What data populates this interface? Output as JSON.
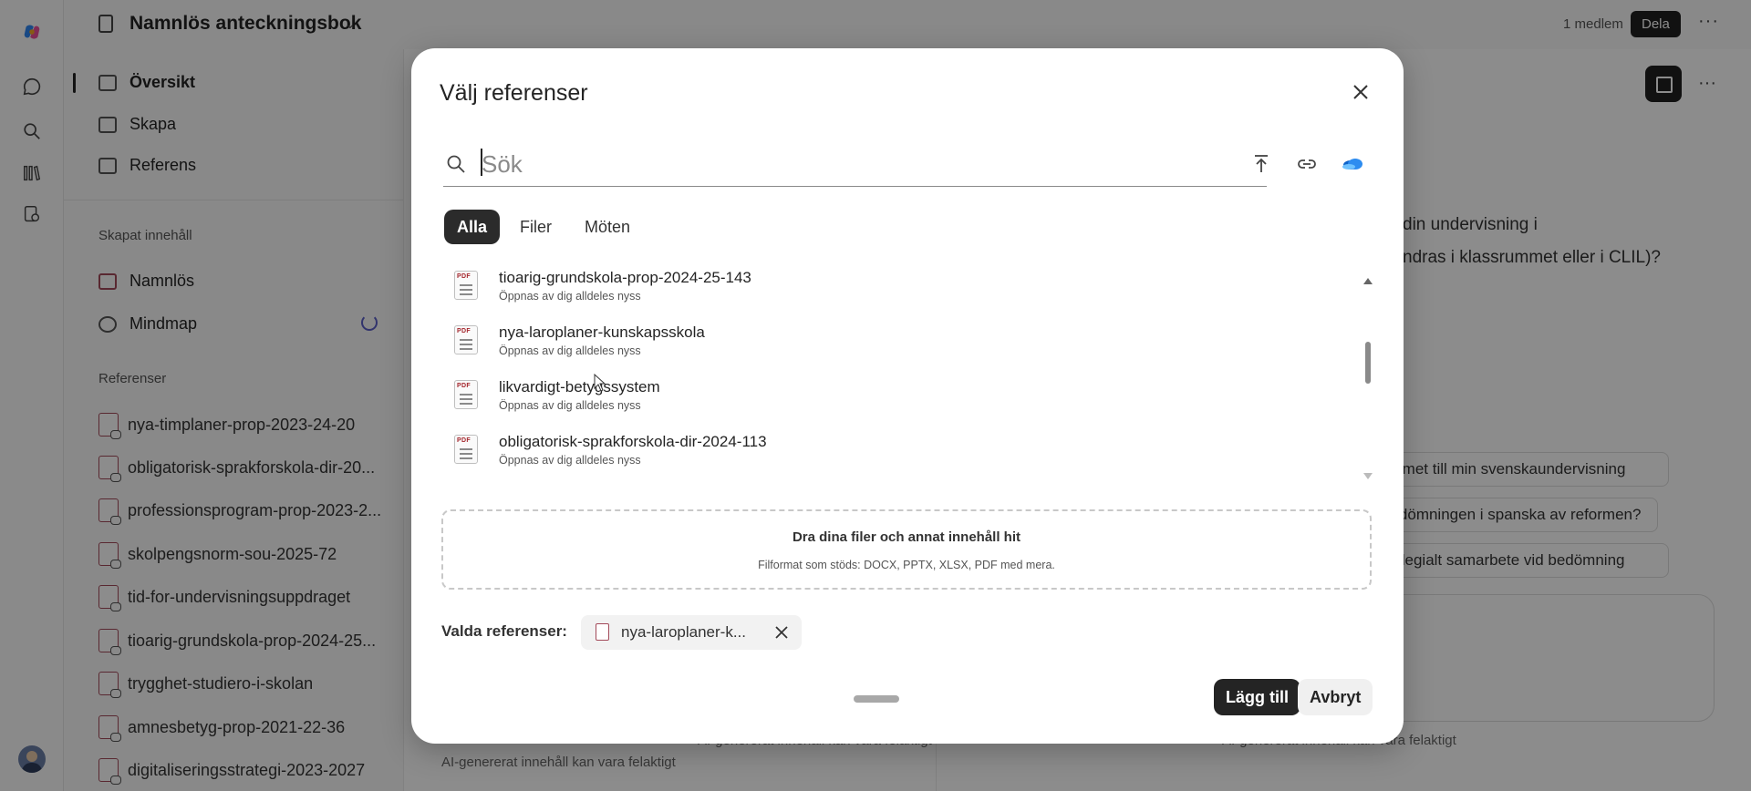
{
  "app": {
    "notebook_title": "Namnlös anteckningsbok",
    "members": "1 medlem",
    "share_label": "Dela"
  },
  "left_panel": {
    "nav": [
      {
        "label": "Översikt",
        "icon": "overview-icon",
        "active": true
      },
      {
        "label": "Skapa",
        "icon": "edit-icon",
        "active": false
      },
      {
        "label": "Referens",
        "icon": "add-icon",
        "active": false
      }
    ],
    "created_heading": "Skapat innehåll",
    "created_items": [
      {
        "label": "Namnlös",
        "icon": "document-icon"
      },
      {
        "label": "Mindmap",
        "icon": "mindmap-icon"
      }
    ],
    "references_heading": "Referenser",
    "references": [
      "nya-timplaner-prop-2023-24-20",
      "obligatorisk-sprakforskola-dir-20...",
      "professionsprogram-prop-2023-2...",
      "skolpengsnorm-sou-2025-72",
      "tid-for-undervisningsuppdraget",
      "tioarig-grundskola-prop-2024-25...",
      "trygghet-studiero-i-skolan",
      "amnesbetyg-prop-2021-22-36",
      "digitaliseringsstrategi-2023-2027"
    ]
  },
  "background": {
    "right_text_1": "din undervisning i",
    "right_text_2": "ndras i klassrummet eller i CLIL)?",
    "chips": [
      "stemet till min svenskaundervisning",
      "bedömningen i spanska av reformen?",
      "kollegialt samarbete vid bedömning"
    ],
    "footnote_center": "AI-genererat innehåll kan vara felaktigt",
    "footnote_bottom_left": "AI-genererat innehåll kan vara felaktigt",
    "footnote_right": "AI-genererat innehåll kan vara felaktigt"
  },
  "dialog": {
    "title": "Välj referenser",
    "search_placeholder": "Sök",
    "search_value": "",
    "tools": [
      {
        "name": "upload-icon",
        "label": "Ladda upp"
      },
      {
        "name": "link-icon",
        "label": "Länk"
      },
      {
        "name": "onedrive-icon",
        "label": "OneDrive"
      }
    ],
    "tabs": [
      {
        "label": "Alla",
        "active": true
      },
      {
        "label": "Filer",
        "active": false
      },
      {
        "label": "Möten",
        "active": false
      }
    ],
    "files": [
      {
        "name": "tioarig-grundskola-prop-2024-25-143",
        "meta": "Öppnas av dig alldeles nyss"
      },
      {
        "name": "nya-laroplaner-kunskapsskola",
        "meta": "Öppnas av dig alldeles nyss"
      },
      {
        "name": "likvardigt-betygssystem",
        "meta": "Öppnas av dig alldeles nyss"
      },
      {
        "name": "obligatorisk-sprakforskola-dir-2024-113",
        "meta": "Öppnas av dig alldeles nyss"
      }
    ],
    "dropzone_title": "Dra dina filer och annat innehåll hit",
    "dropzone_sub": "Filformat som stöds: DOCX, PPTX, XLSX, PDF med mera.",
    "selected_label": "Valda referenser:",
    "selected_items": [
      "nya-laroplaner-k..."
    ],
    "add_label": "Lägg till",
    "cancel_label": "Avbryt"
  },
  "colors": {
    "accent_dark": "#242424",
    "pdf_red": "#a4262c",
    "overlay": "rgba(0,0,0,0.45)"
  }
}
